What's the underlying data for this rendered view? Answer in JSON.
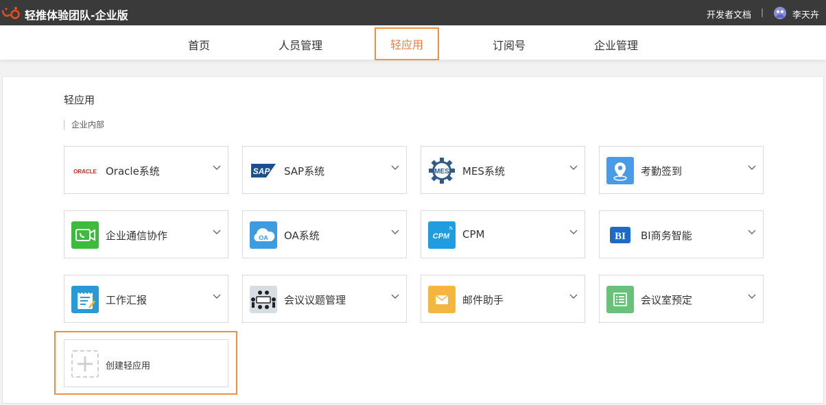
{
  "header": {
    "title": "轻推体验团队-企业版",
    "dev_docs": "开发者文档",
    "separator": "|",
    "user_name": "李天卉",
    "brand_color": "#e94e1b"
  },
  "nav": {
    "items": [
      {
        "label": "首页"
      },
      {
        "label": "人员管理"
      },
      {
        "label": "轻应用",
        "active": true
      },
      {
        "label": "订阅号"
      },
      {
        "label": "企业管理"
      }
    ],
    "active_color": "#f07c3b"
  },
  "main": {
    "section_title": "轻应用",
    "sub_label": "企业内部",
    "apps": [
      {
        "label": "Oracle系统",
        "icon": "oracle-logo-icon",
        "icon_text": "ORACLE"
      },
      {
        "label": "SAP系统",
        "icon": "sap-logo-icon",
        "icon_text": "SAP"
      },
      {
        "label": "MES系统",
        "icon": "mes-gear-icon",
        "icon_text": "MES"
      },
      {
        "label": "考勤签到",
        "icon": "location-pin-icon"
      },
      {
        "label": "企业通信协作",
        "icon": "video-call-icon"
      },
      {
        "label": "OA系统",
        "icon": "oa-cloud-icon",
        "icon_text": "OA"
      },
      {
        "label": "CPM",
        "icon": "cpm-icon",
        "icon_text": "CPM"
      },
      {
        "label": "BI商务智能",
        "icon": "bi-icon",
        "icon_text": "BI"
      },
      {
        "label": "工作汇报",
        "icon": "notepad-icon"
      },
      {
        "label": "会议议题管理",
        "icon": "meeting-table-icon"
      },
      {
        "label": "邮件助手",
        "icon": "envelope-icon"
      },
      {
        "label": "会议室预定",
        "icon": "checklist-icon"
      }
    ],
    "create_label": "创建轻应用"
  }
}
